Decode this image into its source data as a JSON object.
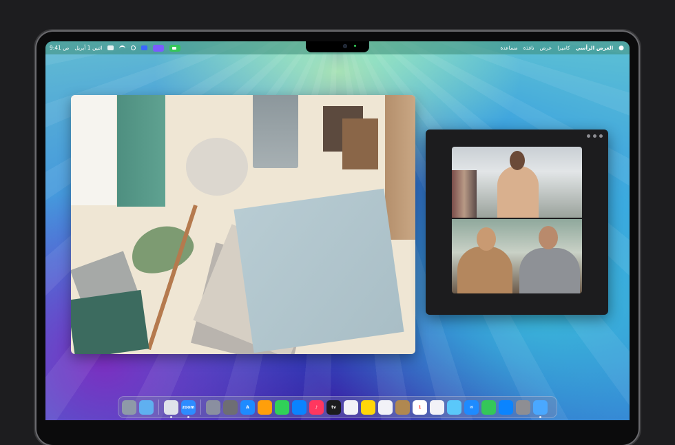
{
  "menubar": {
    "left": {
      "time": "9:41 ص",
      "date": "اثنين 1 أبريل"
    },
    "right": {
      "app_name": "العرض الرأسي",
      "items": [
        "كاميرا",
        "عرض",
        "نافذة",
        "مساعدة"
      ]
    }
  },
  "icons": {
    "apple": "apple-icon",
    "search": "search-icon",
    "wifi": "wifi-icon",
    "control_center": "control-center-icon",
    "facetime_indicator": "facetime-video-icon"
  },
  "colors": {
    "facetime_green": "#34c759",
    "stage_purple": "#7a5cff"
  },
  "dock": {
    "apps": [
      {
        "name": "trash",
        "color": "#8e9aa8",
        "label": ""
      },
      {
        "name": "downloads-folder",
        "color": "#5fb0f0",
        "label": ""
      },
      {
        "name": "preview",
        "color": "#dfe3ea",
        "label": ""
      },
      {
        "name": "zoom",
        "color": "#2d8cff",
        "label": "zoom"
      },
      {
        "name": "notes-pencil",
        "color": "#8a8fa0",
        "label": ""
      },
      {
        "name": "system-settings",
        "color": "#6e6e73",
        "label": ""
      },
      {
        "name": "app-store",
        "color": "#1e8bff",
        "label": "A"
      },
      {
        "name": "pages",
        "color": "#ff9f0a",
        "label": ""
      },
      {
        "name": "numbers",
        "color": "#30d158",
        "label": ""
      },
      {
        "name": "keynote",
        "color": "#0a84ff",
        "label": ""
      },
      {
        "name": "music",
        "color": "#ff375f",
        "label": "♪"
      },
      {
        "name": "apple-tv",
        "color": "#1c1c1e",
        "label": "tv"
      },
      {
        "name": "freeform",
        "color": "#f2f2f7",
        "label": ""
      },
      {
        "name": "notes",
        "color": "#ffd60a",
        "label": ""
      },
      {
        "name": "reminders",
        "color": "#f2f2f7",
        "label": ""
      },
      {
        "name": "contacts",
        "color": "#b08850",
        "label": ""
      },
      {
        "name": "calendar",
        "color": "#ffffff",
        "label": "1"
      },
      {
        "name": "photos",
        "color": "#f2f2f7",
        "label": ""
      },
      {
        "name": "maps",
        "color": "#5ac8fa",
        "label": ""
      },
      {
        "name": "mail",
        "color": "#1e8bff",
        "label": "✉"
      },
      {
        "name": "messages",
        "color": "#34c759",
        "label": ""
      },
      {
        "name": "safari",
        "color": "#0a84ff",
        "label": ""
      },
      {
        "name": "launchpad",
        "color": "#8e8e93",
        "label": ""
      },
      {
        "name": "finder",
        "color": "#4aa8ff",
        "label": ""
      }
    ]
  }
}
